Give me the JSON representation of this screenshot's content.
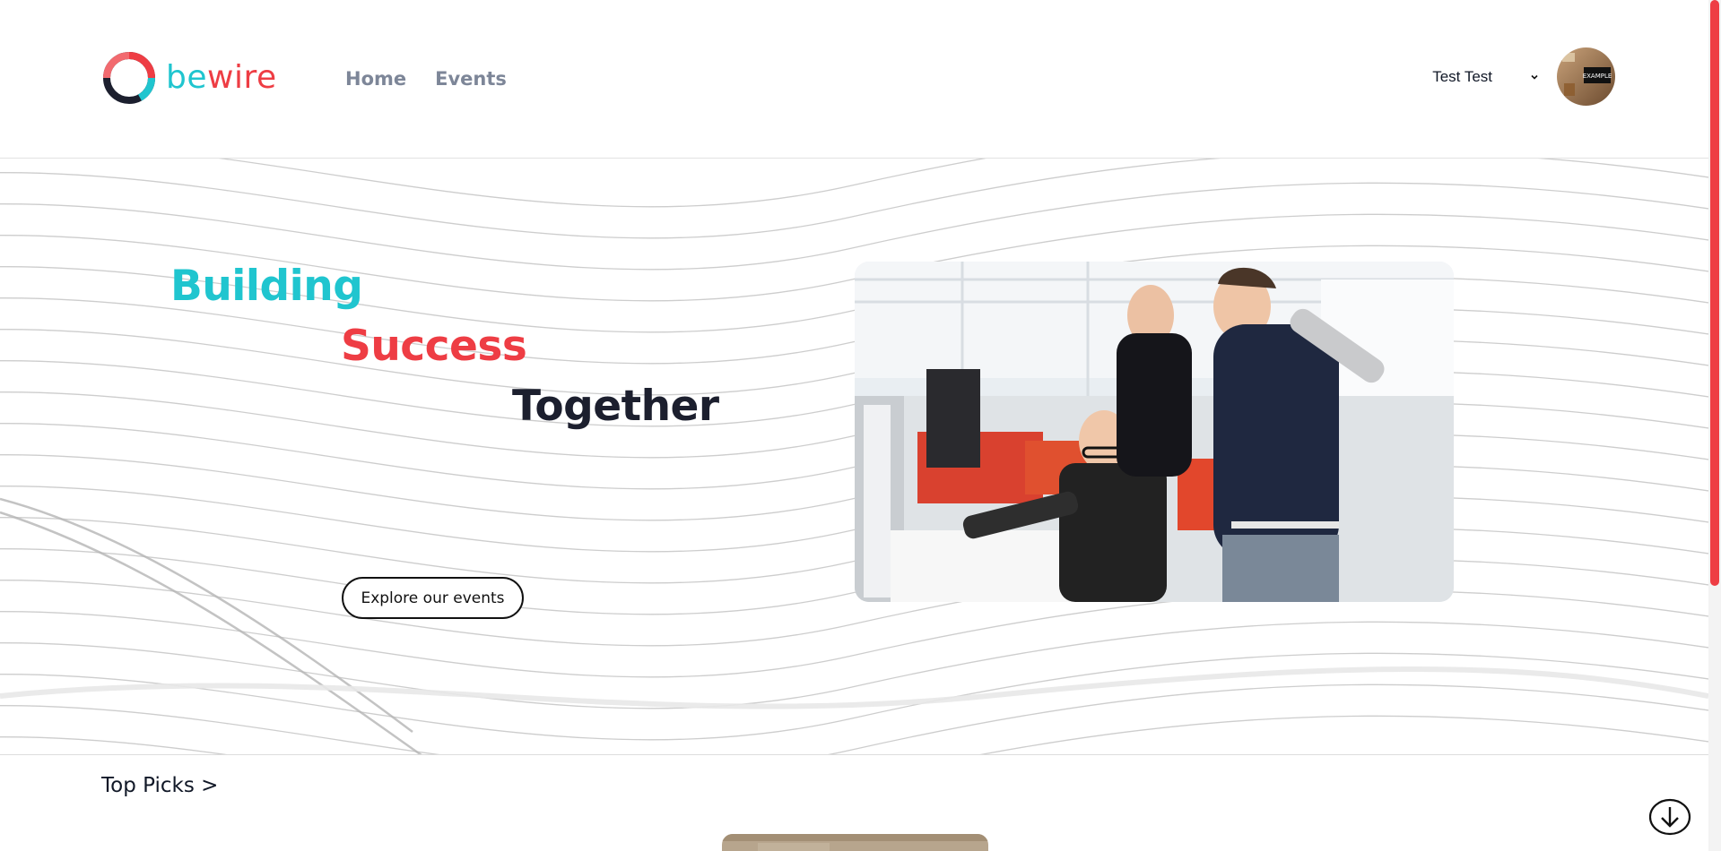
{
  "brand": {
    "name_part1": "be",
    "name_part2": "wire",
    "primary_color": "#20c5cf",
    "accent_color": "#ee3d44"
  },
  "nav": {
    "items": [
      {
        "label": "Home"
      },
      {
        "label": "Events"
      }
    ]
  },
  "user": {
    "name": "Test Test",
    "avatar_text": "EXAMPLE"
  },
  "hero": {
    "line1": "Building",
    "line2": "Success",
    "line3": "Together",
    "cta": "Explore our events"
  },
  "top_picks": {
    "label": "Top Picks >"
  },
  "icons": {
    "logo": "bewire-ring-logo",
    "dropdown": "chevron-down-icon",
    "scroll": "arrow-down-circle-icon"
  }
}
